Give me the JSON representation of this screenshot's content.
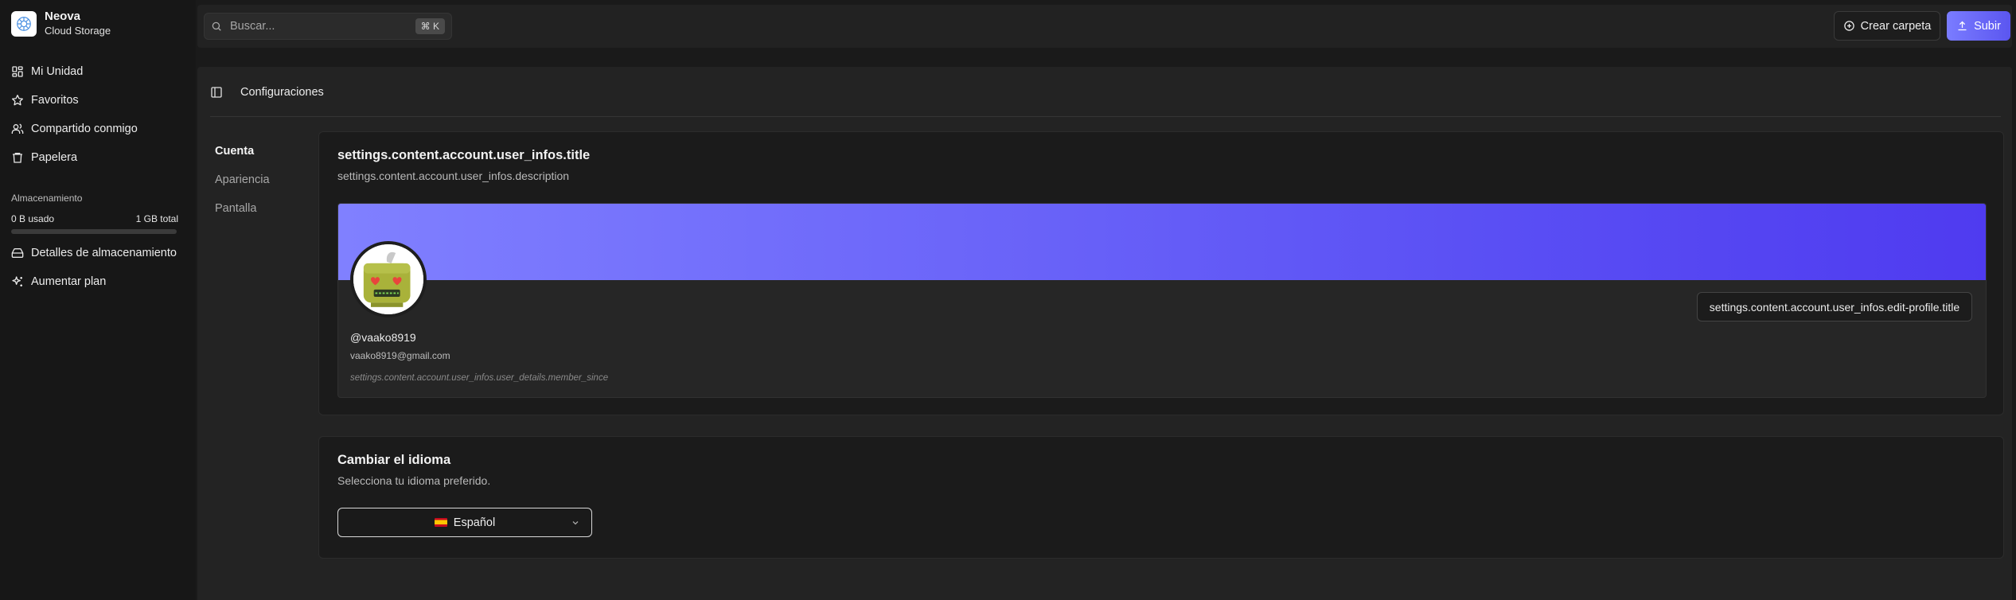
{
  "brand": {
    "name": "Neova",
    "subtitle": "Cloud Storage"
  },
  "sidebar": {
    "items": [
      {
        "label": "Mi Unidad",
        "icon": "grid-icon"
      },
      {
        "label": "Favoritos",
        "icon": "star-icon"
      },
      {
        "label": "Compartido conmigo",
        "icon": "users-icon"
      },
      {
        "label": "Papelera",
        "icon": "trash-icon"
      }
    ],
    "storage": {
      "title": "Almacenamiento",
      "used": "0 B usado",
      "total": "1 GB total",
      "used_fraction": 0
    },
    "secondary": [
      {
        "label": "Detalles de almacenamiento",
        "icon": "hard-drive-icon"
      },
      {
        "label": "Aumentar plan",
        "icon": "sparkles-icon"
      }
    ]
  },
  "topbar": {
    "search_placeholder": "Buscar...",
    "shortcut": "⌘ K",
    "create_folder_label": "Crear carpeta",
    "upload_label": "Subir"
  },
  "page": {
    "title": "Configuraciones"
  },
  "tabs": [
    {
      "label": "Cuenta",
      "active": true
    },
    {
      "label": "Apariencia",
      "active": false
    },
    {
      "label": "Pantalla",
      "active": false
    }
  ],
  "account": {
    "title": "settings.content.account.user_infos.title",
    "description": "settings.content.account.user_infos.description",
    "edit_profile_label": "settings.content.account.user_infos.edit-profile.title",
    "username": "@vaako8919",
    "email": "vaako8919@gmail.com",
    "member_since": "settings.content.account.user_infos.user_details.member_since"
  },
  "language": {
    "title": "Cambiar el idioma",
    "description": "Selecciona tu idioma preferido.",
    "selected": "Español"
  },
  "colors": {
    "accent": "#5b56f0",
    "banner_start": "#8080ff",
    "banner_end": "#4f3bf0"
  }
}
